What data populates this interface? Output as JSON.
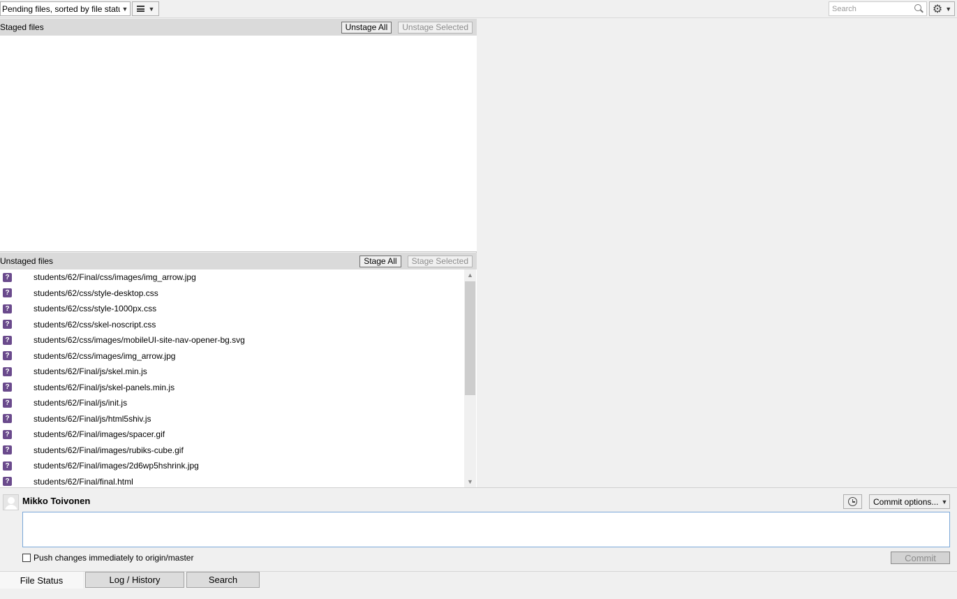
{
  "toolbar": {
    "sort_label": "Pending files, sorted by file status",
    "search_placeholder": "Search"
  },
  "staged": {
    "title": "Staged files",
    "unstage_all": "Unstage All",
    "unstage_selected": "Unstage Selected",
    "files": []
  },
  "unstaged": {
    "title": "Unstaged files",
    "stage_all": "Stage All",
    "stage_selected": "Stage Selected",
    "status_glyph": "?",
    "files": [
      "students/62/Final/css/images/img_arrow.jpg",
      "students/62/css/style-desktop.css",
      "students/62/css/style-1000px.css",
      "students/62/css/skel-noscript.css",
      "students/62/css/images/mobileUI-site-nav-opener-bg.svg",
      "students/62/css/images/img_arrow.jpg",
      "students/62/Final/js/skel.min.js",
      "students/62/Final/js/skel-panels.min.js",
      "students/62/Final/js/init.js",
      "students/62/Final/js/html5shiv.js",
      "students/62/Final/images/spacer.gif",
      "students/62/Final/images/rubiks-cube.gif",
      "students/62/Final/images/2d6wp5hshrink.jpg",
      "students/62/Final/final.html"
    ]
  },
  "commit": {
    "author": "Mikko Toivonen",
    "options_label": "Commit options...",
    "message": "",
    "push_label": "Push changes immediately to origin/master",
    "commit_label": "Commit"
  },
  "tabs": {
    "file_status": "File Status",
    "log_history": "Log / History",
    "search": "Search"
  },
  "icons": {
    "search": "search-icon",
    "gear": "gear-icon",
    "history": "clock-icon",
    "view": "list-view-icon",
    "status": "untracked-status-icon"
  },
  "colors": {
    "untracked_icon": "#6a4a8c",
    "focus_border": "#7aa7d8",
    "header_bg": "#dadada"
  }
}
